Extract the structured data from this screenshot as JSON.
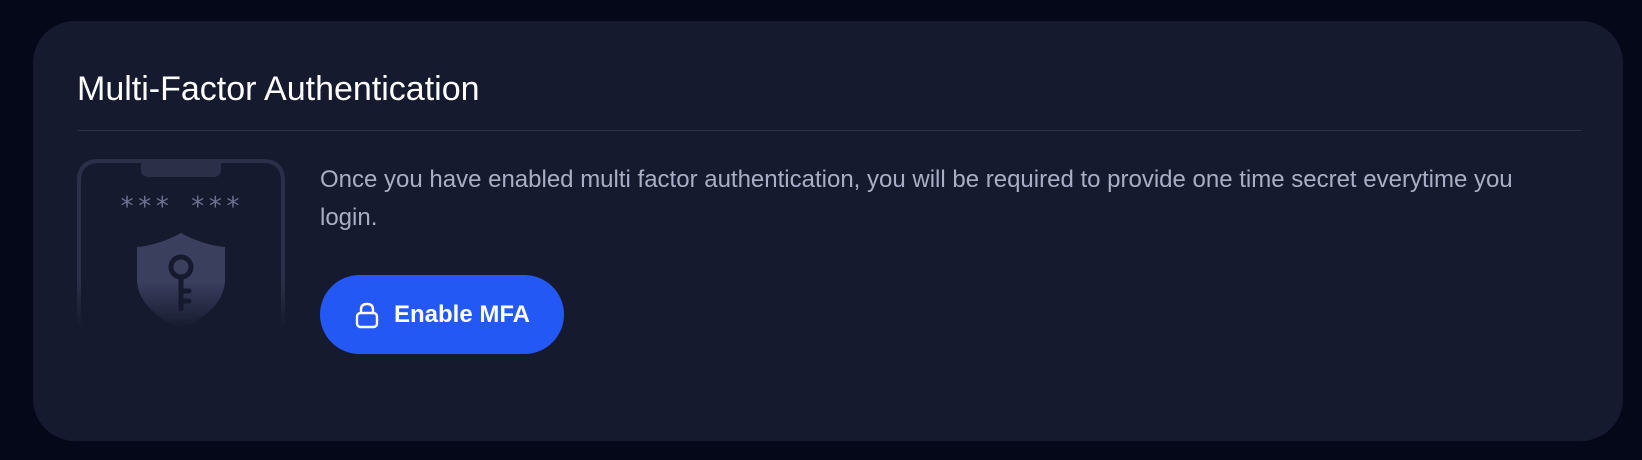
{
  "card": {
    "title": "Multi-Factor Authentication",
    "description": "Once you have enabled multi factor authentication, you will be required to provide one time secret everytime you login.",
    "illustration": {
      "secret_mask": "*** ***",
      "icon": "shield-key-icon"
    },
    "button": {
      "label": "Enable MFA",
      "icon": "lock-icon"
    }
  },
  "colors": {
    "page_background": "#050818",
    "card_background": "#161a2e",
    "accent": "#2458f5",
    "text_primary": "#ffffff",
    "text_secondary": "#a9aec6"
  }
}
